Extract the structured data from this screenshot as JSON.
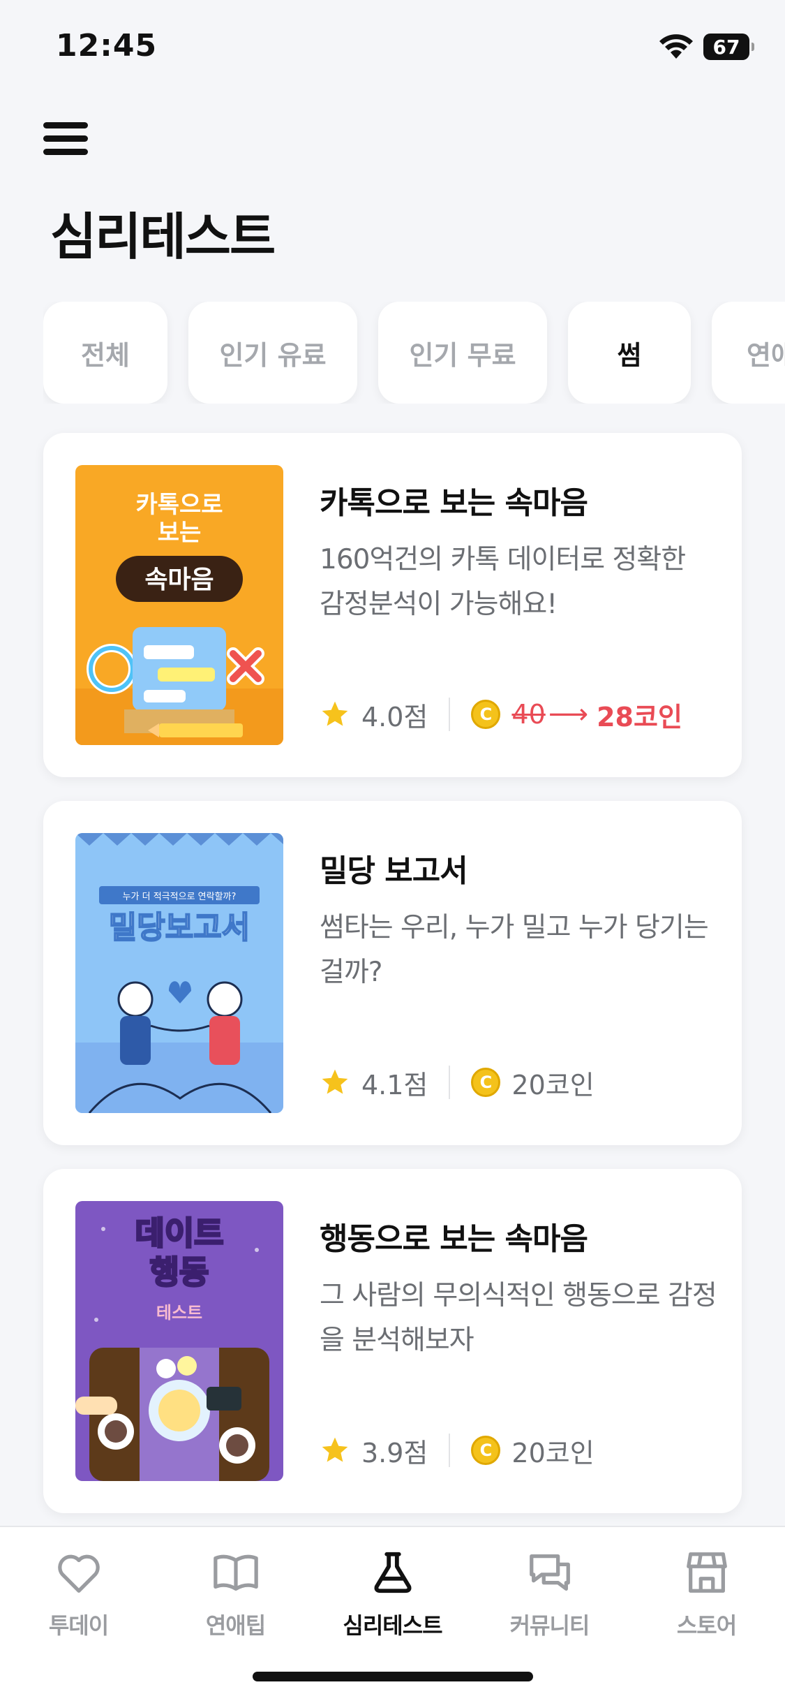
{
  "status_bar": {
    "time": "12:45",
    "battery": "67"
  },
  "header": {
    "title": "심리테스트"
  },
  "chips": [
    {
      "label": "전체",
      "active": false
    },
    {
      "label": "인기 유료",
      "active": false
    },
    {
      "label": "인기 무료",
      "active": false
    },
    {
      "label": "썸",
      "active": true
    },
    {
      "label": "연애",
      "active": false
    }
  ],
  "cards": [
    {
      "title": "카톡으로 보는 속마음",
      "description": "160억건의 카톡 데이터로 정확한 감정분석이 가능해요!",
      "rating": "4.0점",
      "price_old": "40",
      "price": "28코인",
      "thumb_text": {
        "line1": "카톡으로",
        "line2": "보는",
        "bubble": "속마음"
      }
    },
    {
      "title": "밀당 보고서",
      "description": "썸타는 우리, 누가 밀고 누가 당기는 걸까?",
      "rating": "4.1점",
      "price": "20코인",
      "thumb_text": {
        "ribbon": "누가 더 적극적으로 연락할까?",
        "title": "밀당보고서"
      }
    },
    {
      "title": "행동으로 보는 속마음",
      "description": "그 사람의 무의식적인 행동으로 감정을 분석해보자",
      "rating": "3.9점",
      "price": "20코인",
      "thumb_text": {
        "line1": "데이트",
        "line2": "행동",
        "line3": "테스트"
      }
    }
  ],
  "coin_symbol": "C",
  "tabs": [
    {
      "label": "투데이",
      "icon": "heart-icon",
      "active": false
    },
    {
      "label": "연애팁",
      "icon": "book-icon",
      "active": false
    },
    {
      "label": "심리테스트",
      "icon": "flask-icon",
      "active": true
    },
    {
      "label": "커뮤니티",
      "icon": "chat-icon",
      "active": false
    },
    {
      "label": "스토어",
      "icon": "store-icon",
      "active": false
    }
  ],
  "colors": {
    "accent_red": "#e94b55",
    "star": "#f6c21c",
    "coin": "#f4c21b"
  }
}
